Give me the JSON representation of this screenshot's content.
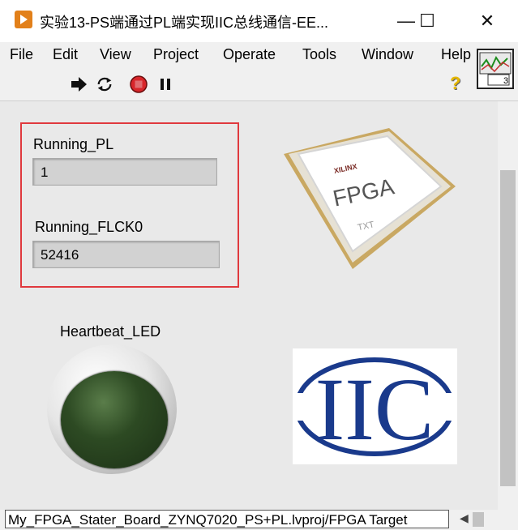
{
  "window": {
    "title": "实验13-PS端通过PL端实现IIC总线通信-EE...",
    "minimize": "—",
    "maximize": "☐",
    "close": "✕"
  },
  "menu": {
    "items": [
      "File",
      "Edit",
      "View",
      "Project",
      "Operate",
      "Tools",
      "Window",
      "Help"
    ]
  },
  "toolbar": {
    "icons": [
      "run-arrow-icon",
      "run-continuously-icon",
      "abort-icon",
      "pause-icon"
    ],
    "help": "?",
    "connector_text": "3"
  },
  "front_panel": {
    "running_pl": {
      "label": "Running_PL",
      "value": "1"
    },
    "running_flck0": {
      "label": "Running_FLCK0",
      "value": "52416"
    },
    "heartbeat_led": {
      "label": "Heartbeat_LED",
      "state": "off",
      "color": "#2d4a23"
    },
    "fpga_image": {
      "brand": "XILINX",
      "text": "FPGA",
      "mark": "TXT"
    },
    "iic_logo": {
      "text": "IIC"
    }
  },
  "statusbar": {
    "path": "My_FPGA_Stater_Board_ZYNQ7020_PS+PL.lvproj/FPGA Target",
    "scroll_left": "◀"
  },
  "colors": {
    "highlight": "#e0393e",
    "panel_bg": "#e9e9e9",
    "iic_blue": "#1a3a8c"
  }
}
